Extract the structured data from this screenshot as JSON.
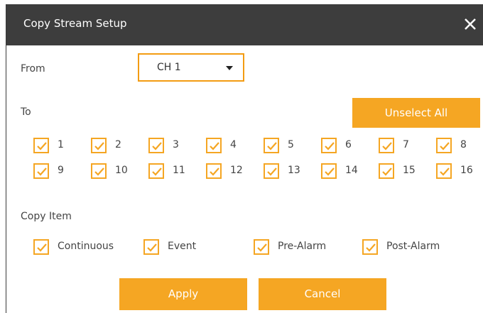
{
  "dialog": {
    "title": "Copy Stream Setup",
    "from_label": "From",
    "from_value": "CH 1",
    "to_label": "To",
    "unselect_all_label": "Unselect All",
    "copy_item_label": "Copy Item",
    "apply_label": "Apply",
    "cancel_label": "Cancel",
    "accent_color": "#f5a623",
    "titlebar_color": "#3d3d3d",
    "channels": [
      {
        "label": "1",
        "checked": true
      },
      {
        "label": "2",
        "checked": true
      },
      {
        "label": "3",
        "checked": true
      },
      {
        "label": "4",
        "checked": true
      },
      {
        "label": "5",
        "checked": true
      },
      {
        "label": "6",
        "checked": true
      },
      {
        "label": "7",
        "checked": true
      },
      {
        "label": "8",
        "checked": true
      },
      {
        "label": "9",
        "checked": true
      },
      {
        "label": "10",
        "checked": true
      },
      {
        "label": "11",
        "checked": true
      },
      {
        "label": "12",
        "checked": true
      },
      {
        "label": "13",
        "checked": true
      },
      {
        "label": "14",
        "checked": true
      },
      {
        "label": "15",
        "checked": true
      },
      {
        "label": "16",
        "checked": true
      }
    ],
    "copy_items": [
      {
        "label": "Continuous",
        "checked": true
      },
      {
        "label": "Event",
        "checked": true
      },
      {
        "label": "Pre-Alarm",
        "checked": true
      },
      {
        "label": "Post-Alarm",
        "checked": true
      }
    ]
  }
}
